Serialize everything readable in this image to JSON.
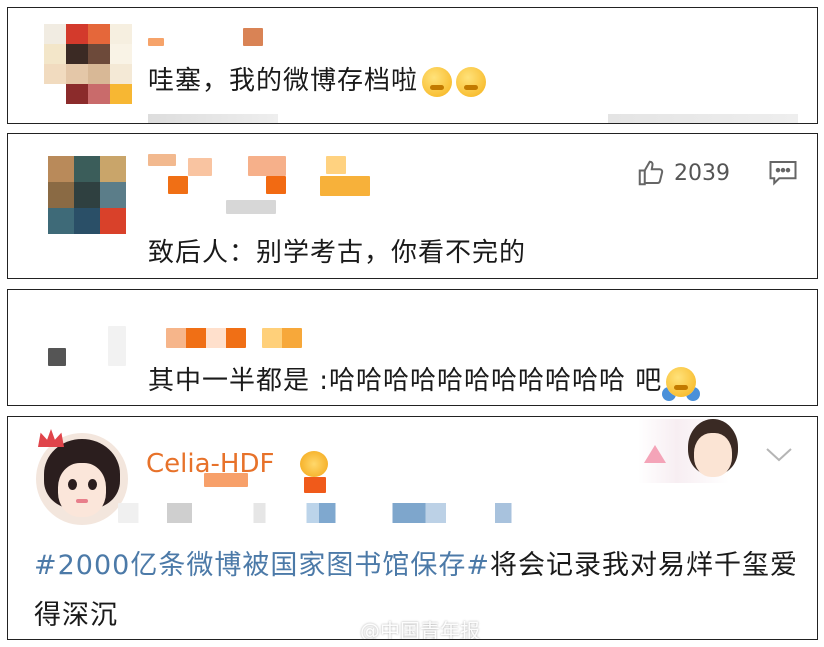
{
  "comments": [
    {
      "text": "哇塞，我的微博存档啦"
    },
    {
      "text": "致后人：别学考古，你看不完的",
      "likes": "2039"
    },
    {
      "text": "其中一半都是 :哈哈哈哈哈哈哈哈哈哈哈 吧"
    },
    {
      "username": "Celia-HDF",
      "hashtag": "#2000亿条微博被国家图书馆保存#",
      "text": "将会记录我对易烊千玺爱得深沉"
    }
  ],
  "watermark": "@中国青年报",
  "icons": [
    "grin-emoji-icon",
    "thumbs-up-icon",
    "comment-icon",
    "chevron-down-icon",
    "crown-badge-icon",
    "shrug-emoji-icon",
    "weibo-logo-icon"
  ],
  "colors": {
    "hashtag": "#4c7aa8",
    "orange_blur": "#f47a1c",
    "border": "#222222"
  }
}
